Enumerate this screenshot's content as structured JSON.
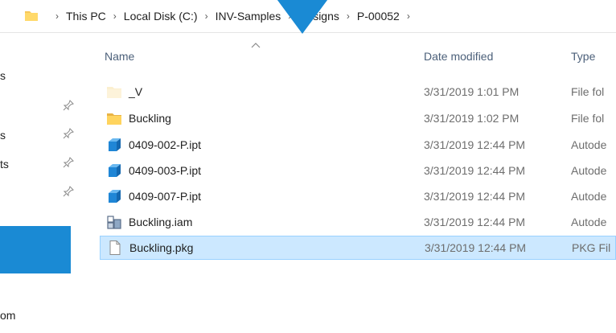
{
  "address_bar": {
    "breadcrumbs": [
      "This PC",
      "Local Disk (C:)",
      "INV-Samples",
      "Designs",
      "P-00052"
    ]
  },
  "nav_pane": {
    "items": [
      {
        "label": "s",
        "pinned": false
      },
      {
        "label": "",
        "pinned": true
      },
      {
        "label": "s",
        "pinned": true
      },
      {
        "label": "ts",
        "pinned": true
      },
      {
        "label": "",
        "pinned": true
      },
      {
        "label": "om",
        "pinned": false
      }
    ],
    "selected_color": "#1a8ad4"
  },
  "file_list": {
    "columns": [
      "Name",
      "Date modified",
      "Type"
    ],
    "rows": [
      {
        "name": "_V",
        "date": "3/31/2019 1:01 PM",
        "type": "File fol",
        "icon": "folder-faded-icon"
      },
      {
        "name": "Buckling",
        "date": "3/31/2019 1:02 PM",
        "type": "File fol",
        "icon": "folder-icon"
      },
      {
        "name": "0409-002-P.ipt",
        "date": "3/31/2019 12:44 PM",
        "type": "Autode",
        "icon": "inventor-part-icon"
      },
      {
        "name": "0409-003-P.ipt",
        "date": "3/31/2019 12:44 PM",
        "type": "Autode",
        "icon": "inventor-part-icon"
      },
      {
        "name": "0409-007-P.ipt",
        "date": "3/31/2019 12:44 PM",
        "type": "Autode",
        "icon": "inventor-part-icon"
      },
      {
        "name": "Buckling.iam",
        "date": "3/31/2019 12:44 PM",
        "type": "Autode",
        "icon": "inventor-assembly-icon"
      },
      {
        "name": "Buckling.pkg",
        "date": "3/31/2019 12:44 PM",
        "type": "PKG Fil",
        "icon": "generic-file-icon",
        "selected": true
      }
    ]
  },
  "colors": {
    "selection_bg": "#cce8ff",
    "selection_border": "#99d1ff",
    "header_text": "#4c607a",
    "overlay_arrow": "#1a8ad4"
  }
}
